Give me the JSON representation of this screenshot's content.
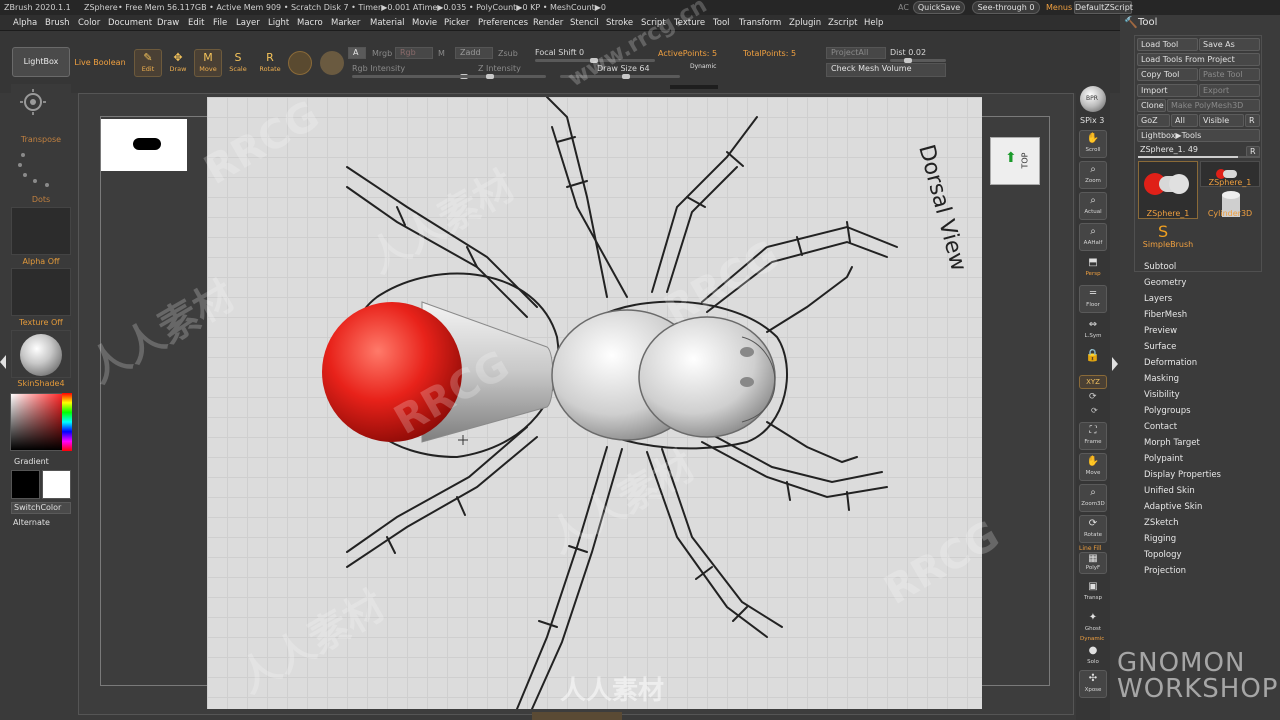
{
  "titlebar": {
    "app": "ZBrush 2020.1.1",
    "doc": "ZSphere",
    "stats": "• Free Mem 56.117GB • Active Mem 909 • Scratch Disk 7 • Timer▶0.001 ATime▶0.035 • PolyCount▶0 KP • MeshCount▶0",
    "ac": "AC",
    "quicksave": "QuickSave",
    "seethrough": "See-through  0",
    "menus": "Menus",
    "defaultzscript": "DefaultZScript"
  },
  "menubar": [
    "Alpha",
    "Brush",
    "Color",
    "Document",
    "Draw",
    "Edit",
    "File",
    "Layer",
    "Light",
    "Macro",
    "Marker",
    "Material",
    "Movie",
    "Picker",
    "Preferences",
    "Render",
    "Stencil",
    "Stroke",
    "Script",
    "Texture",
    "Tool",
    "Transform",
    "Zplugin",
    "Zscript",
    "Help"
  ],
  "shelf": {
    "lightbox": "LightBox",
    "live_boolean": "Live Boolean",
    "edit": "Edit",
    "draw": "Draw",
    "move": "Move",
    "scale": "Scale",
    "rotate": "Rotate",
    "a": "A",
    "mrgb": "Mrgb",
    "rgb": "Rgb",
    "m": "M",
    "zadd": "Zadd",
    "zsub": "Zsub",
    "rgb_intensity": "Rgb Intensity",
    "z_intensity": "Z Intensity",
    "focal_shift": "Focal Shift 0",
    "draw_size": "Draw Size 64",
    "dynamic": "Dynamic",
    "active_points": "ActivePoints: 5",
    "total_points": "TotalPoints: 5",
    "project_all": "ProjectAll",
    "dist": "Dist 0.02",
    "check_mesh_volume": "Check Mesh Volume"
  },
  "lefttray": {
    "transpose": "Transpose",
    "dots": "Dots",
    "alpha_off": "Alpha Off",
    "texture_off": "Texture Off",
    "material": "SkinShade4",
    "gradient": "Gradient",
    "switchcolor": "SwitchColor",
    "alternate": "Alternate"
  },
  "rightshelf": [
    {
      "label": "BPR",
      "icon": "sphere-icon"
    },
    {
      "label": "SPix 3",
      "icon": ""
    },
    {
      "label": "Scroll",
      "icon": "hand-icon"
    },
    {
      "label": "Zoom",
      "icon": "magnifier-icon"
    },
    {
      "label": "Actual",
      "icon": "magnifier-icon"
    },
    {
      "label": "AAHalf",
      "icon": "magnifier-icon"
    },
    {
      "label": "Persp",
      "icon": "perspective-icon"
    },
    {
      "label": "Floor",
      "icon": "floor-icon"
    },
    {
      "label": "L.Sym",
      "icon": "symmetry-icon"
    },
    {
      "label": "XYZ",
      "icon": ""
    },
    {
      "label": "Frame",
      "icon": "frame-icon"
    },
    {
      "label": "Move",
      "icon": "hand-icon"
    },
    {
      "label": "Zoom3D",
      "icon": "magnifier-icon"
    },
    {
      "label": "Rotate",
      "icon": "rotate-icon"
    },
    {
      "label": "Line Fill",
      "icon": ""
    },
    {
      "label": "PolyF",
      "icon": "grid-icon"
    },
    {
      "label": "Transp",
      "icon": "transp-icon"
    },
    {
      "label": "Ghost",
      "icon": "ghost-icon"
    },
    {
      "label": "Dynamic",
      "icon": ""
    },
    {
      "label": "Solo",
      "icon": "solo-icon"
    },
    {
      "label": "Xpose",
      "icon": "xpose-icon"
    }
  ],
  "toolpanel": {
    "title": "Tool",
    "load_tool": "Load Tool",
    "save_as": "Save As",
    "load_from_project": "Load Tools From Project",
    "copy_tool": "Copy Tool",
    "paste_tool": "Paste Tool",
    "import": "Import",
    "export": "Export",
    "clone": "Clone",
    "make_polymesh": "Make PolyMesh3D",
    "goz": "GoZ",
    "all": "All",
    "visible": "Visible",
    "r": "R",
    "lightbox_tools": "Lightbox▶Tools",
    "current_tool": "ZSphere_1. 49",
    "r2": "R",
    "thumbs": [
      "ZSphere_1",
      "ZSphere_1",
      "Cylinder3D",
      "SimpleBrush"
    ],
    "subpalettes": [
      "Subtool",
      "Geometry",
      "Layers",
      "FiberMesh",
      "Preview",
      "Surface",
      "Deformation",
      "Masking",
      "Visibility",
      "Polygroups",
      "Contact",
      "Morph Target",
      "Polypaint",
      "Display Properties",
      "Unified Skin",
      "Adaptive Skin",
      "ZSketch",
      "Rigging",
      "Topology",
      "Projection"
    ]
  },
  "canvas": {
    "sketch_text": "Dorsal View",
    "nav_cube": "TOP"
  },
  "watermarks": [
    "www.rrcg.cn",
    "RRCG",
    "人人素材"
  ],
  "branding": "GNOMON WORKSHOP",
  "colors": {
    "accent": "#f0a040",
    "zsphere_red": "#e8221a",
    "panel": "#3b3b3b"
  }
}
